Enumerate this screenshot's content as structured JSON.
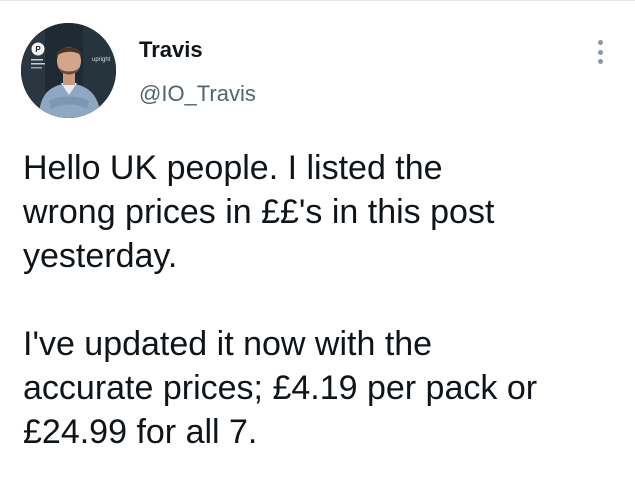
{
  "tweet": {
    "author": {
      "display_name": "Travis",
      "handle": "@IO_Travis",
      "avatar_icon": "profile-photo"
    },
    "more_icon": "vertical-ellipsis-icon",
    "text": {
      "paragraph_1": [
        "Hello UK people. I listed the",
        "wrong prices in ££'s in this post",
        "yesterday."
      ],
      "paragraph_2": [
        "I've updated it now with the",
        "accurate prices; £4.19 per pack or",
        "£24.99 for all 7."
      ]
    },
    "avatar_text": {
      "logo_letter": "P",
      "banner_text": "upright"
    }
  }
}
